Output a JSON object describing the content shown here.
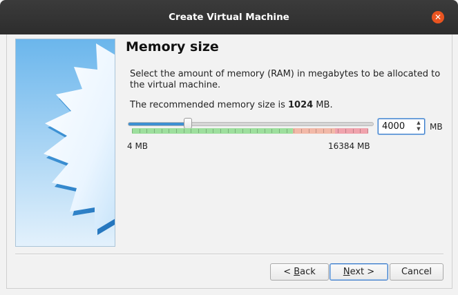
{
  "window": {
    "title": "Create Virtual Machine",
    "close_glyph": "✕"
  },
  "page": {
    "heading": "Memory size",
    "description": "Select the amount of memory (RAM) in megabytes to be allocated to the virtual machine.",
    "recommend_prefix": "The recommended memory size is ",
    "recommend_value": "1024",
    "recommend_suffix": " MB."
  },
  "memory": {
    "min_label": "4 MB",
    "max_label": "16384 MB",
    "min_mb": 4,
    "max_mb": 16384,
    "value_mb": 4000,
    "value_text": "4000",
    "unit": "MB",
    "spin_up_glyph": "▲",
    "spin_down_glyph": "▼"
  },
  "buttons": {
    "back_prefix": "< ",
    "back_mnemonic": "B",
    "back_rest": "ack",
    "next_mnemonic": "N",
    "next_rest": "ext >",
    "cancel": "Cancel"
  },
  "colors": {
    "scale_ok": "#9ddf9d",
    "scale_warn": "#f2b9a8",
    "scale_danger": "#f0a3ad",
    "accent": "#3d8fd1",
    "close": "#e95420"
  }
}
